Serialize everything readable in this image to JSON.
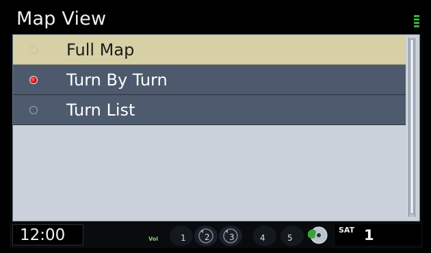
{
  "header": {
    "title": "Map View"
  },
  "menu": {
    "items": [
      {
        "label": "Full Map",
        "selected": false,
        "highlighted": true
      },
      {
        "label": "Turn By Turn",
        "selected": true,
        "highlighted": false
      },
      {
        "label": "Turn List",
        "selected": false,
        "highlighted": false
      }
    ]
  },
  "status_bar": {
    "clock": "12:00",
    "volume_label": "Vol",
    "presets": [
      "1",
      "2",
      "3",
      "4",
      "5"
    ],
    "band": "SAT",
    "channel": "1"
  },
  "colors": {
    "highlight_row": "#d7cfa6",
    "row_dark": "#4d5a6d",
    "content_bg": "#cbd1da",
    "radio_selected": "#d01010"
  },
  "icons": {
    "signal": "signal-strength-icon",
    "disc": "disc-icon",
    "volume": "volume-icon"
  }
}
